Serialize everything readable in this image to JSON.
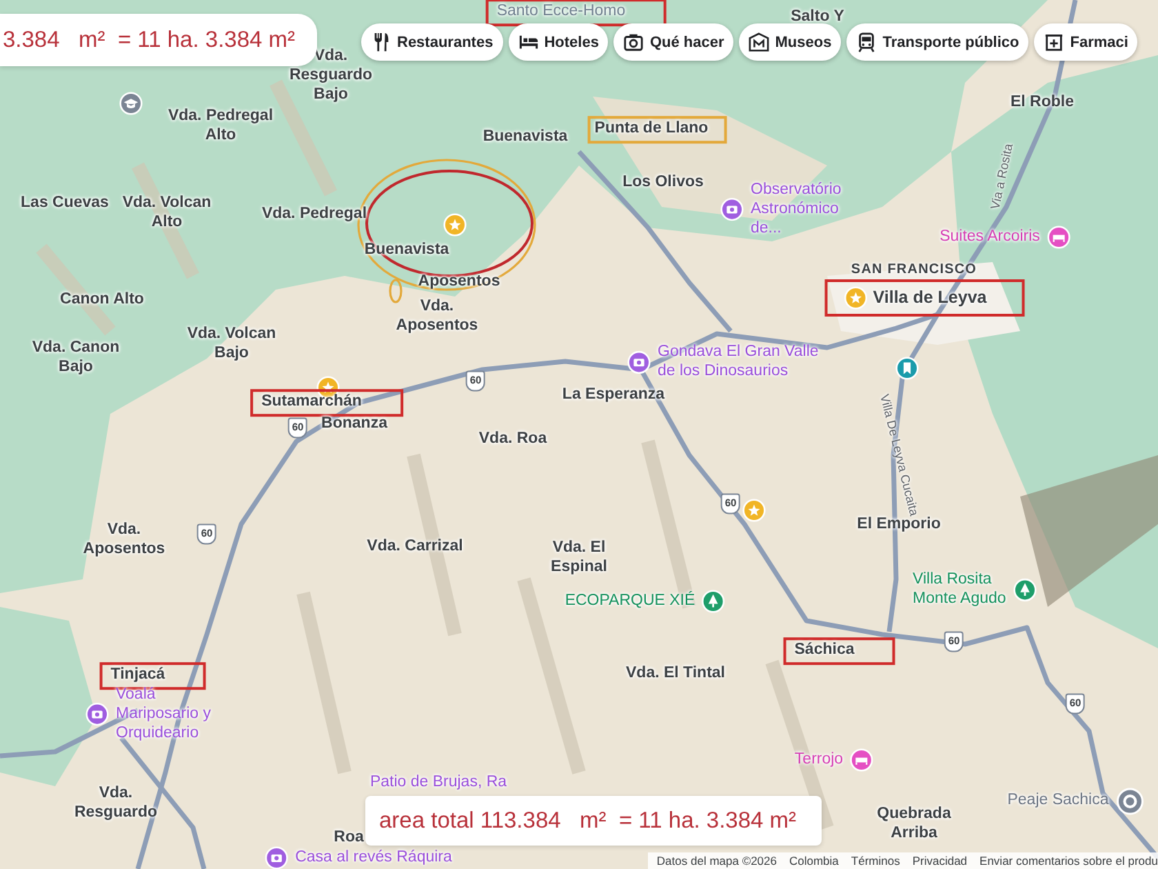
{
  "measurement_top": {
    "text": "3.384   m²  = 11 ha. 3.384 m²"
  },
  "categories": [
    {
      "label": "Restaurantes",
      "kind": "restaurant"
    },
    {
      "label": "Hoteles",
      "kind": "hotel"
    },
    {
      "label": "Qué hacer",
      "kind": "camera"
    },
    {
      "label": "Museos",
      "kind": "museum"
    },
    {
      "label": "Transporte público",
      "kind": "transit"
    },
    {
      "label": "Farmaci",
      "kind": "pharmacy"
    }
  ],
  "labels": [
    {
      "text": "Santo Ecce-Homo",
      "kind": "boxed"
    },
    {
      "text": "Salto Y",
      "kind": "place"
    },
    {
      "text": "Vda. Resguardo Bajo",
      "kind": "place"
    },
    {
      "text": "Vda. Pedregal Alto",
      "kind": "place"
    },
    {
      "text": "Buenavista",
      "kind": "place"
    },
    {
      "text": "Punta de Llano",
      "kind": "boxed-orange"
    },
    {
      "text": "El Roble",
      "kind": "place"
    },
    {
      "text": "Los Olivos",
      "kind": "place"
    },
    {
      "text": "Las Cuevas",
      "kind": "place"
    },
    {
      "text": "Vda. Volcan Alto",
      "kind": "place"
    },
    {
      "text": "Vda. Pedregal",
      "kind": "place"
    },
    {
      "text": "Observatório Astronómico de...",
      "kind": "poi"
    },
    {
      "text": "Via a Rosita",
      "kind": "road"
    },
    {
      "text": "Suites Arcoiris",
      "kind": "hotel"
    },
    {
      "text": "Buenavista",
      "kind": "place"
    },
    {
      "text": "Canon Alto",
      "kind": "place"
    },
    {
      "text": "Aposentos",
      "kind": "place"
    },
    {
      "text": "Vda. Aposentos",
      "kind": "place"
    },
    {
      "text": "SAN FRANCISCO",
      "kind": "caps"
    },
    {
      "text": "Villa de Leyva",
      "kind": "boxed-star"
    },
    {
      "text": "Vda. Canon Bajo",
      "kind": "place"
    },
    {
      "text": "Vda. Volcan Bajo",
      "kind": "place"
    },
    {
      "text": "Gondava El Gran Valle de los Dinosaurios",
      "kind": "poi"
    },
    {
      "text": "Sutamarchán",
      "kind": "boxed"
    },
    {
      "text": "La Esperanza",
      "kind": "place"
    },
    {
      "text": "Bonanza",
      "kind": "place"
    },
    {
      "text": "Vda. Roa",
      "kind": "place"
    },
    {
      "text": "Villa De Leyva Cucaita",
      "kind": "road"
    },
    {
      "text": "Vda. Aposentos",
      "kind": "place"
    },
    {
      "text": "Vda. Carrizal",
      "kind": "place"
    },
    {
      "text": "Vda. El Espinal",
      "kind": "place"
    },
    {
      "text": "El Emporio",
      "kind": "place"
    },
    {
      "text": "ECOPARQUE XIÉ",
      "kind": "park"
    },
    {
      "text": "Villa Rosita Monte Agudo",
      "kind": "park"
    },
    {
      "text": "Tinjacá",
      "kind": "boxed"
    },
    {
      "text": "Vda. El Tintal",
      "kind": "place"
    },
    {
      "text": "Sáchica",
      "kind": "boxed"
    },
    {
      "text": "Voalá Mariposario y Orquideario",
      "kind": "poi"
    },
    {
      "text": "Terrojo",
      "kind": "hotel"
    },
    {
      "text": "Patio de Brujas, Ra",
      "kind": "poi-text"
    },
    {
      "text": "Vda. Resguardo",
      "kind": "place"
    },
    {
      "text": "Roa",
      "kind": "place"
    },
    {
      "text": "Quebrada Arriba",
      "kind": "place"
    },
    {
      "text": "Peaje Sachica",
      "kind": "toll"
    },
    {
      "text": "Casa al revés Ráquira",
      "kind": "poi"
    }
  ],
  "road_shields": [
    "60",
    "60",
    "60",
    "60",
    "60",
    "60"
  ],
  "measurement_bottom": {
    "text": "area total 113.384   m²  = 11 ha. 3.384 m²"
  },
  "footer": [
    "Datos del mapa ©2026",
    "Colombia",
    "Términos",
    "Privacidad",
    "Enviar comentarios sobre el produ"
  ]
}
